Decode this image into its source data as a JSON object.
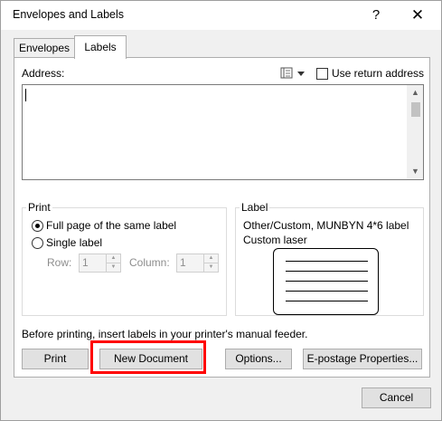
{
  "window": {
    "title": "Envelopes and Labels",
    "help_glyph": "?",
    "close_glyph": "✕"
  },
  "tabs": [
    {
      "label": "Envelopes",
      "active": false
    },
    {
      "label": "Labels",
      "active": true
    }
  ],
  "address": {
    "label": "Address:",
    "value": "",
    "use_return_address_label": "Use return address",
    "use_return_address_checked": false
  },
  "print_group": {
    "title": "Print",
    "full_page_label": "Full page of the same label",
    "full_page_selected": true,
    "single_label": "Single label",
    "single_selected": false,
    "row_label": "Row:",
    "row_value": "1",
    "column_label": "Column:",
    "column_value": "1"
  },
  "label_group": {
    "title": "Label",
    "name": "Other/Custom, MUNBYN 4*6 label",
    "type": "Custom laser"
  },
  "notice": "Before printing, insert labels in your printer's manual feeder.",
  "buttons": {
    "print": "Print",
    "new_document": "New Document",
    "options": "Options...",
    "epostage": "E-postage Properties...",
    "cancel": "Cancel"
  },
  "colors": {
    "highlight": "#ff0000"
  }
}
